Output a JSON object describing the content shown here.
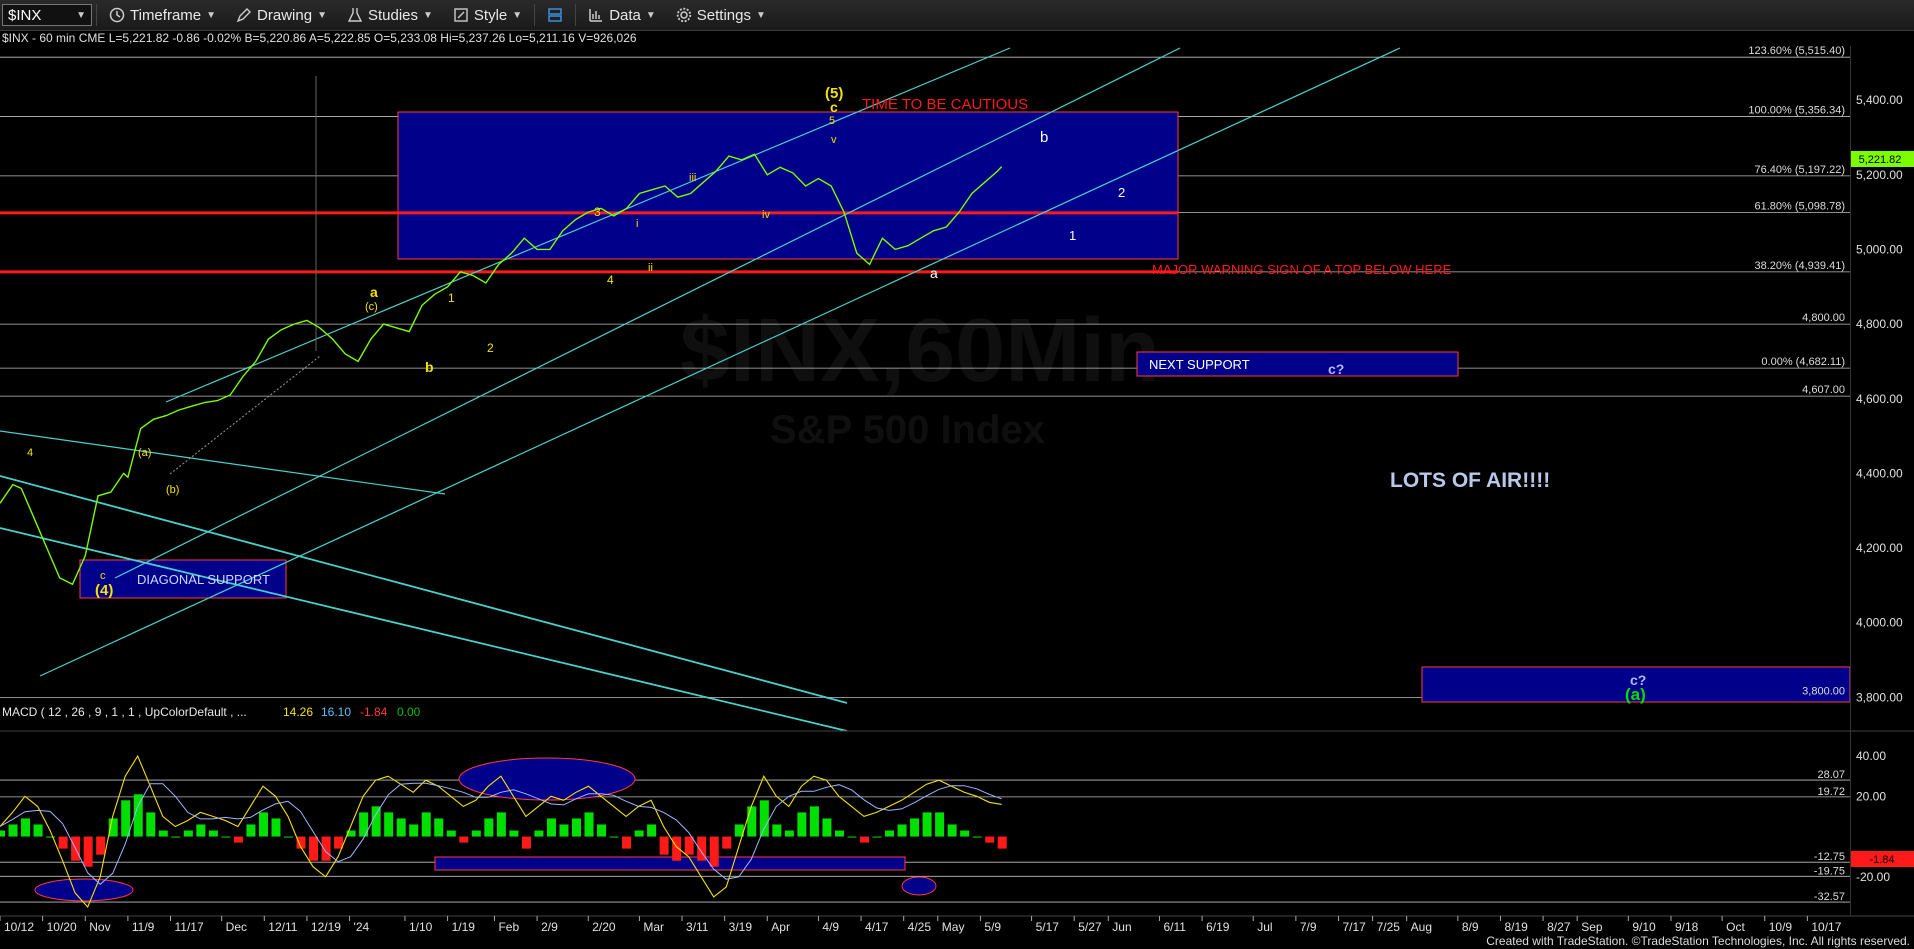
{
  "toolbar": {
    "symbol": "$INX",
    "timeframe": "Timeframe",
    "drawing": "Drawing",
    "studies": "Studies",
    "style": "Style",
    "data": "Data",
    "settings": "Settings"
  },
  "colors": {
    "price": "#7cfc00",
    "overlay": "#e6d300",
    "channel": "#48d1cc",
    "support": "#ff1a1a",
    "box": "#00008b",
    "macd_hist_pos": "#00e000",
    "macd_hist_neg": "#ff1a1a"
  },
  "header": {
    "quote": "$INX - 60 min  CME  L=5,221.82  -0.86  -0.02%  B=5,220.86  A=5,222.85  O=5,233.08  Hi=5,237.26  Lo=5,211.16  V=926,026"
  },
  "watermark": {
    "symbol": "$INX,60Min",
    "name": "S&P 500 Index"
  },
  "chart_data": {
    "type": "line",
    "title": "$INX - 60 min",
    "ylim": [
      3710,
      5545
    ],
    "price_axis_ticks": [
      "5,400.00",
      "5,200.00",
      "5,000.00",
      "4,800.00",
      "4,600.00",
      "4,400.00",
      "4,200.00",
      "4,000.00",
      "3,800.00"
    ],
    "price_axis_ticks_values": [
      5400,
      5200,
      5000,
      4800,
      4600,
      4400,
      4200,
      4000,
      3800
    ],
    "last_price": "5,221.82",
    "x_ticks": [
      "10/12",
      "10/20",
      "Nov",
      "11/9",
      "11/17",
      "Dec",
      "12/11",
      "12/19",
      "'24",
      "1/10",
      "1/19",
      "Feb",
      "2/9",
      "2/20",
      "Mar",
      "3/11",
      "3/19",
      "Apr",
      "4/9",
      "4/17",
      "4/25",
      "May",
      "5/9",
      "5/17",
      "5/27",
      "Jun",
      "6/11",
      "6/19",
      "Jul",
      "7/9",
      "7/17",
      "7/25",
      "Aug",
      "8/9",
      "8/19",
      "8/27",
      "Sep",
      "9/10",
      "9/18",
      "Oct",
      "10/9",
      "10/17"
    ],
    "x_tick_bars": [
      0,
      10,
      20,
      30,
      40,
      52,
      62,
      72,
      82,
      95,
      105,
      116,
      126,
      138,
      150,
      160,
      170,
      180,
      192,
      202,
      212,
      220,
      230,
      242,
      252,
      260,
      272,
      282,
      294,
      304,
      314,
      322,
      330,
      342,
      352,
      362,
      370,
      382,
      392,
      404,
      414,
      424
    ],
    "x_range_bars": [
      0,
      434
    ],
    "series": [
      {
        "name": "$INX",
        "x": [
          0,
          3,
          5,
          8,
          11,
          14,
          17,
          20,
          23,
          26,
          29,
          30,
          33,
          36,
          39,
          42,
          45,
          48,
          51,
          54,
          57,
          60,
          63,
          66,
          69,
          72,
          75,
          78,
          81,
          84,
          87,
          90,
          93,
          96,
          99,
          102,
          105,
          108,
          111,
          114,
          117,
          120,
          123,
          126,
          129,
          132,
          135,
          138,
          141,
          144,
          147,
          150,
          153,
          156,
          159,
          162,
          165,
          168,
          171,
          174,
          177,
          180,
          183,
          186,
          189,
          192,
          195,
          198,
          201,
          204,
          207,
          210,
          213,
          216,
          219,
          222,
          225,
          228,
          231,
          234,
          235
        ],
        "values": [
          4320,
          4370,
          4360,
          4280,
          4200,
          4120,
          4103,
          4180,
          4340,
          4350,
          4400,
          4390,
          4520,
          4545,
          4555,
          4570,
          4580,
          4590,
          4595,
          4610,
          4660,
          4700,
          4760,
          4785,
          4800,
          4810,
          4790,
          4760,
          4720,
          4700,
          4760,
          4800,
          4790,
          4780,
          4850,
          4880,
          4900,
          4940,
          4930,
          4910,
          4960,
          4990,
          5030,
          5000,
          5000,
          5050,
          5080,
          5100,
          5110,
          5090,
          5110,
          5150,
          5160,
          5170,
          5140,
          5150,
          5180,
          5210,
          5250,
          5240,
          5255,
          5200,
          5220,
          5205,
          5170,
          5190,
          5170,
          5100,
          4990,
          4960,
          5030,
          5000,
          5010,
          5030,
          5050,
          5060,
          5100,
          5150,
          5180,
          5210,
          5222
        ]
      }
    ],
    "h_levels": [
      {
        "label": "123.60% (5,515.40)",
        "value": 5515
      },
      {
        "label": "100.00% (5,356.34)",
        "value": 5356
      },
      {
        "label": "76.40% (5,197.22)",
        "value": 5197
      },
      {
        "label": "61.80% (5,098.78)",
        "value": 5099
      },
      {
        "label": "38.20% (4,939.41)",
        "value": 4940
      },
      {
        "label": "4,800.00",
        "value": 4800
      },
      {
        "label": "0.00% (4,682.11)",
        "value": 4682
      },
      {
        "label": "4,607.00",
        "value": 4607
      },
      {
        "label": "3,800.00",
        "value": 3800
      }
    ],
    "red_levels": [
      5098,
      4940
    ],
    "macd": {
      "title": "MACD ( 12 , 26 , 9 , 1 , 1 , UpColorDefault , ...",
      "values": [
        "14.26",
        "16.10",
        "-1.84",
        "0.00"
      ],
      "ylim": [
        -37,
        45
      ],
      "levels": [
        {
          "label": "28.07",
          "value": 28.07
        },
        {
          "label": "19.72",
          "value": 19.72
        },
        {
          "label": "-12.75",
          "value": -12.75
        },
        {
          "label": "-19.75",
          "value": -19.75
        },
        {
          "label": "-32.57",
          "value": -32.57
        }
      ],
      "axis_ticks": [
        {
          "label": "40.00",
          "value": 40
        },
        {
          "label": "20.00",
          "value": 20
        },
        {
          "label": "-20.00",
          "value": -20
        }
      ],
      "last": "-1.84",
      "macd_line": [
        5,
        12,
        20,
        15,
        3,
        -12,
        -28,
        -35,
        -20,
        10,
        30,
        40,
        25,
        10,
        5,
        8,
        12,
        10,
        8,
        5,
        15,
        25,
        20,
        10,
        -5,
        -15,
        -20,
        -10,
        5,
        20,
        28,
        30,
        26,
        22,
        28,
        25,
        20,
        15,
        18,
        25,
        30,
        20,
        10,
        15,
        20,
        18,
        22,
        25,
        20,
        15,
        10,
        15,
        18,
        5,
        -5,
        -10,
        -20,
        -30,
        -25,
        -5,
        15,
        30,
        20,
        15,
        25,
        30,
        28,
        20,
        15,
        10,
        12,
        15,
        18,
        22,
        26,
        28,
        25,
        22,
        20,
        17,
        16
      ],
      "hist": [
        1,
        2,
        3,
        2,
        0,
        -2,
        -4,
        -5,
        -3,
        3,
        6,
        7,
        4,
        1,
        0,
        1,
        2,
        1,
        0,
        -1,
        2,
        4,
        3,
        0,
        -2,
        -4,
        -4,
        -2,
        1,
        4,
        5,
        4,
        3,
        2,
        4,
        3,
        1,
        -1,
        1,
        3,
        4,
        1,
        -2,
        1,
        3,
        2,
        3,
        4,
        2,
        0,
        -2,
        1,
        2,
        -3,
        -4,
        -3,
        -4,
        -5,
        -2,
        2,
        5,
        6,
        2,
        1,
        4,
        5,
        3,
        1,
        0,
        -1,
        0,
        1,
        2,
        3,
        4,
        4,
        2,
        1,
        0,
        -1,
        -2
      ]
    }
  },
  "annotations": {
    "time_cautious": "TIME TO BE CAUTIOUS",
    "major_warning": "MAJOR WARNING SIGN OF A TOP BELOW HERE",
    "next_support": "NEXT SUPPORT",
    "c_q": "c?",
    "lots_air": "LOTS OF AIR!!!!",
    "diagonal": "DIAGONAL SUPPORT",
    "wave5": "(5)",
    "wave5c": "c",
    "wave5_5": "5",
    "wave_v": "v",
    "b_top": "b",
    "a_low": "a",
    "two": "2",
    "one": "1",
    "iii": "iii",
    "iv": "iv",
    "i": "i",
    "ii": "ii",
    "three": "3",
    "four": "4",
    "a_yel": "a",
    "c_paren": "(c)",
    "b_yel": "b",
    "one_y": "1",
    "two_y": "2",
    "a_paren": "(a)",
    "b_paren": "(b)",
    "four_paren": "(4)",
    "c_small": "c",
    "four_l": "4",
    "c_q2": "c?",
    "a_green": "(a)"
  },
  "footer": "Created with TradeStation. ©TradeStation Technologies, Inc. All rights reserved."
}
